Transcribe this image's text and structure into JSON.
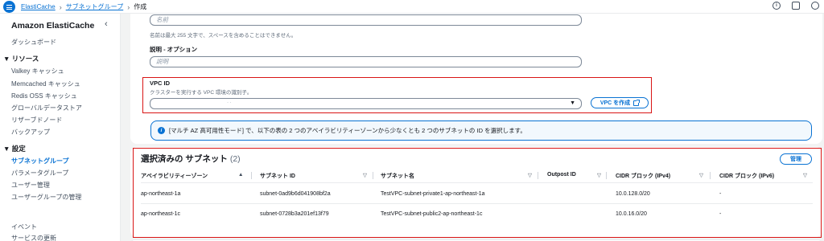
{
  "topbar": {
    "breadcrumbs": [
      "ElastiCache",
      "サブネットグループ",
      "作成"
    ]
  },
  "sidebar": {
    "title": "Amazon ElastiCache",
    "close": "‹",
    "dashboard": "ダッシュボード",
    "resources_header": "▼ リソース",
    "resources": [
      "Valkey キャッシュ",
      "Memcached キャッシュ",
      "Redis OSS キャッシュ",
      "グローバルデータストア",
      "リザーブドノード",
      "バックアップ"
    ],
    "settings_header": "▼ 設定",
    "settings": [
      "サブネットグループ",
      "パラメータグループ",
      "ユーザー管理",
      "ユーザーグループの管理"
    ],
    "events": "イベント",
    "service_updates": "サービスの更新"
  },
  "form": {
    "name_placeholder": "名前",
    "name_hint": "名前は最大 255 文字で、スペースを含めることはできません。",
    "description_label": "説明 - オプション",
    "description_placeholder": "説明",
    "vpc_label": "VPC ID",
    "vpc_hint": "クラスターを実行する VPC 環境の識別子。",
    "vpc_value": "·             ·",
    "create_vpc": "VPC を作成",
    "info_text": "[マルチ AZ 高可用性モード] で、以下の表の 2 つのアベイラビリティーゾーンから少なくとも 2 つのサブネットの ID を選択します。"
  },
  "table": {
    "title": "選択済みの サブネット",
    "count": "(2)",
    "manage": "管理",
    "columns": [
      "アベイラビリティーゾーン",
      "サブネット ID",
      "サブネット名",
      "Outpost ID",
      "CIDR ブロック (IPv4)",
      "CIDR ブロック (IPv6)"
    ],
    "rows": [
      [
        "ap-northeast-1a",
        "subnet-0ad9b6d041908bf2a",
        "TestVPC-subnet-private1-ap-northeast-1a",
        "",
        "10.0.128.0/20",
        "-"
      ],
      [
        "ap-northeast-1c",
        "subnet-0728b3a201ef13f79",
        "TestVPC-subnet-public2-ap-northeast-1c",
        "",
        "10.0.16.0/20",
        "-"
      ]
    ]
  },
  "colors": {
    "accent": "#0972d3",
    "highlight": "#d91515"
  }
}
